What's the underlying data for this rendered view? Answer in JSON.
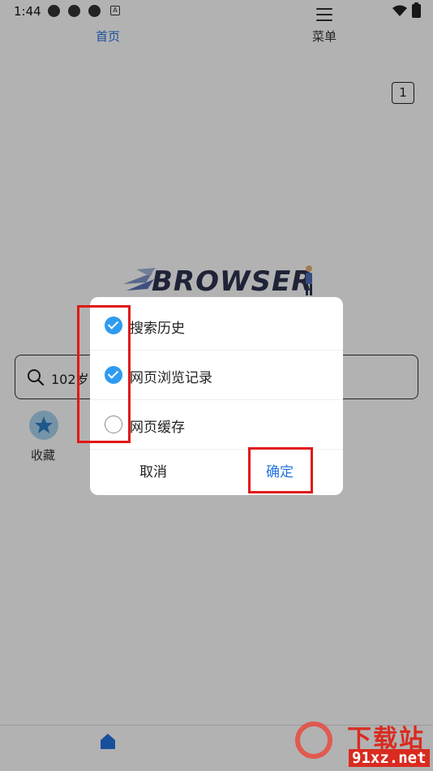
{
  "status_bar": {
    "time": "1:44",
    "notification_letter": "A"
  },
  "tab_count": "1",
  "logo_text": "BROWSER",
  "search": {
    "text": "102岁"
  },
  "shortcuts": [
    {
      "label": "收藏"
    }
  ],
  "bottom_nav": {
    "home_label": "首页",
    "menu_label": "菜单"
  },
  "dialog": {
    "options": [
      {
        "label": "搜索历史",
        "checked": true
      },
      {
        "label": "网页浏览记录",
        "checked": true
      },
      {
        "label": "网页缓存",
        "checked": false
      }
    ],
    "cancel_label": "取消",
    "confirm_label": "确定"
  },
  "watermark": {
    "title": "下载站",
    "url": "91xz.net"
  },
  "colors": {
    "accent": "#2573e0",
    "check": "#2d9bf0",
    "annotation": "#e01818",
    "logo": "#2b3350"
  }
}
